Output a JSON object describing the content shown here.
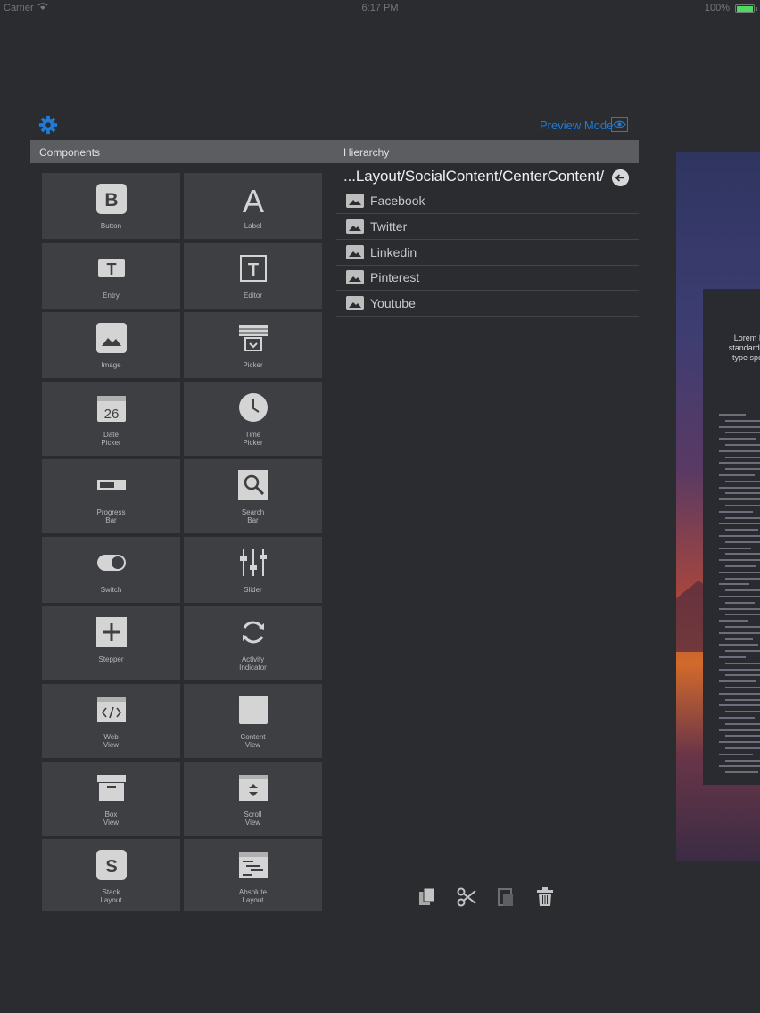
{
  "status": {
    "carrier": "Carrier",
    "time": "6:17 PM",
    "battery": "100%"
  },
  "toolbar": {
    "preview_label": "Preview Mode",
    "gear_icon": "gear-icon",
    "preview_icon": "eye-icon",
    "accent": "#1e7bd8"
  },
  "headers": {
    "components": "Components",
    "hierarchy": "Hierarchy"
  },
  "components": [
    {
      "label": "Button",
      "icon": "button-icon"
    },
    {
      "label": "Label",
      "icon": "label-icon"
    },
    {
      "label": "Entry",
      "icon": "entry-icon"
    },
    {
      "label": "Editor",
      "icon": "editor-icon"
    },
    {
      "label": "Image",
      "icon": "image-icon"
    },
    {
      "label": "Picker",
      "icon": "picker-icon"
    },
    {
      "label": "Date\nPicker",
      "icon": "calendar-icon"
    },
    {
      "label": "Time\nPicker",
      "icon": "clock-icon"
    },
    {
      "label": "Progress\nBar",
      "icon": "progress-bar-icon"
    },
    {
      "label": "Search\nBar",
      "icon": "search-icon"
    },
    {
      "label": "Switch",
      "icon": "switch-icon"
    },
    {
      "label": "Slider",
      "icon": "slider-icon"
    },
    {
      "label": "Stepper",
      "icon": "plus-icon"
    },
    {
      "label": "Activity\nIndicator",
      "icon": "refresh-icon"
    },
    {
      "label": "Web\nView",
      "icon": "code-icon"
    },
    {
      "label": "Content\nView",
      "icon": "square-icon"
    },
    {
      "label": "Box\nView",
      "icon": "box-icon"
    },
    {
      "label": "Scroll\nView",
      "icon": "scroll-icon"
    },
    {
      "label": "Stack\nLayout",
      "icon": "stack-icon"
    },
    {
      "label": "Absolute\nLayout",
      "icon": "absolute-layout-icon"
    }
  ],
  "hierarchy": {
    "path": "...Layout/SocialContent/CenterContent/",
    "items": [
      "Facebook",
      "Twitter",
      "Linkedin",
      "Pinterest",
      "Youtube"
    ]
  },
  "actions": [
    "copy-icon",
    "cut-icon",
    "paste-icon",
    "trash-icon"
  ],
  "preview_text": "Lorem I\nstandard d\ntype spe"
}
